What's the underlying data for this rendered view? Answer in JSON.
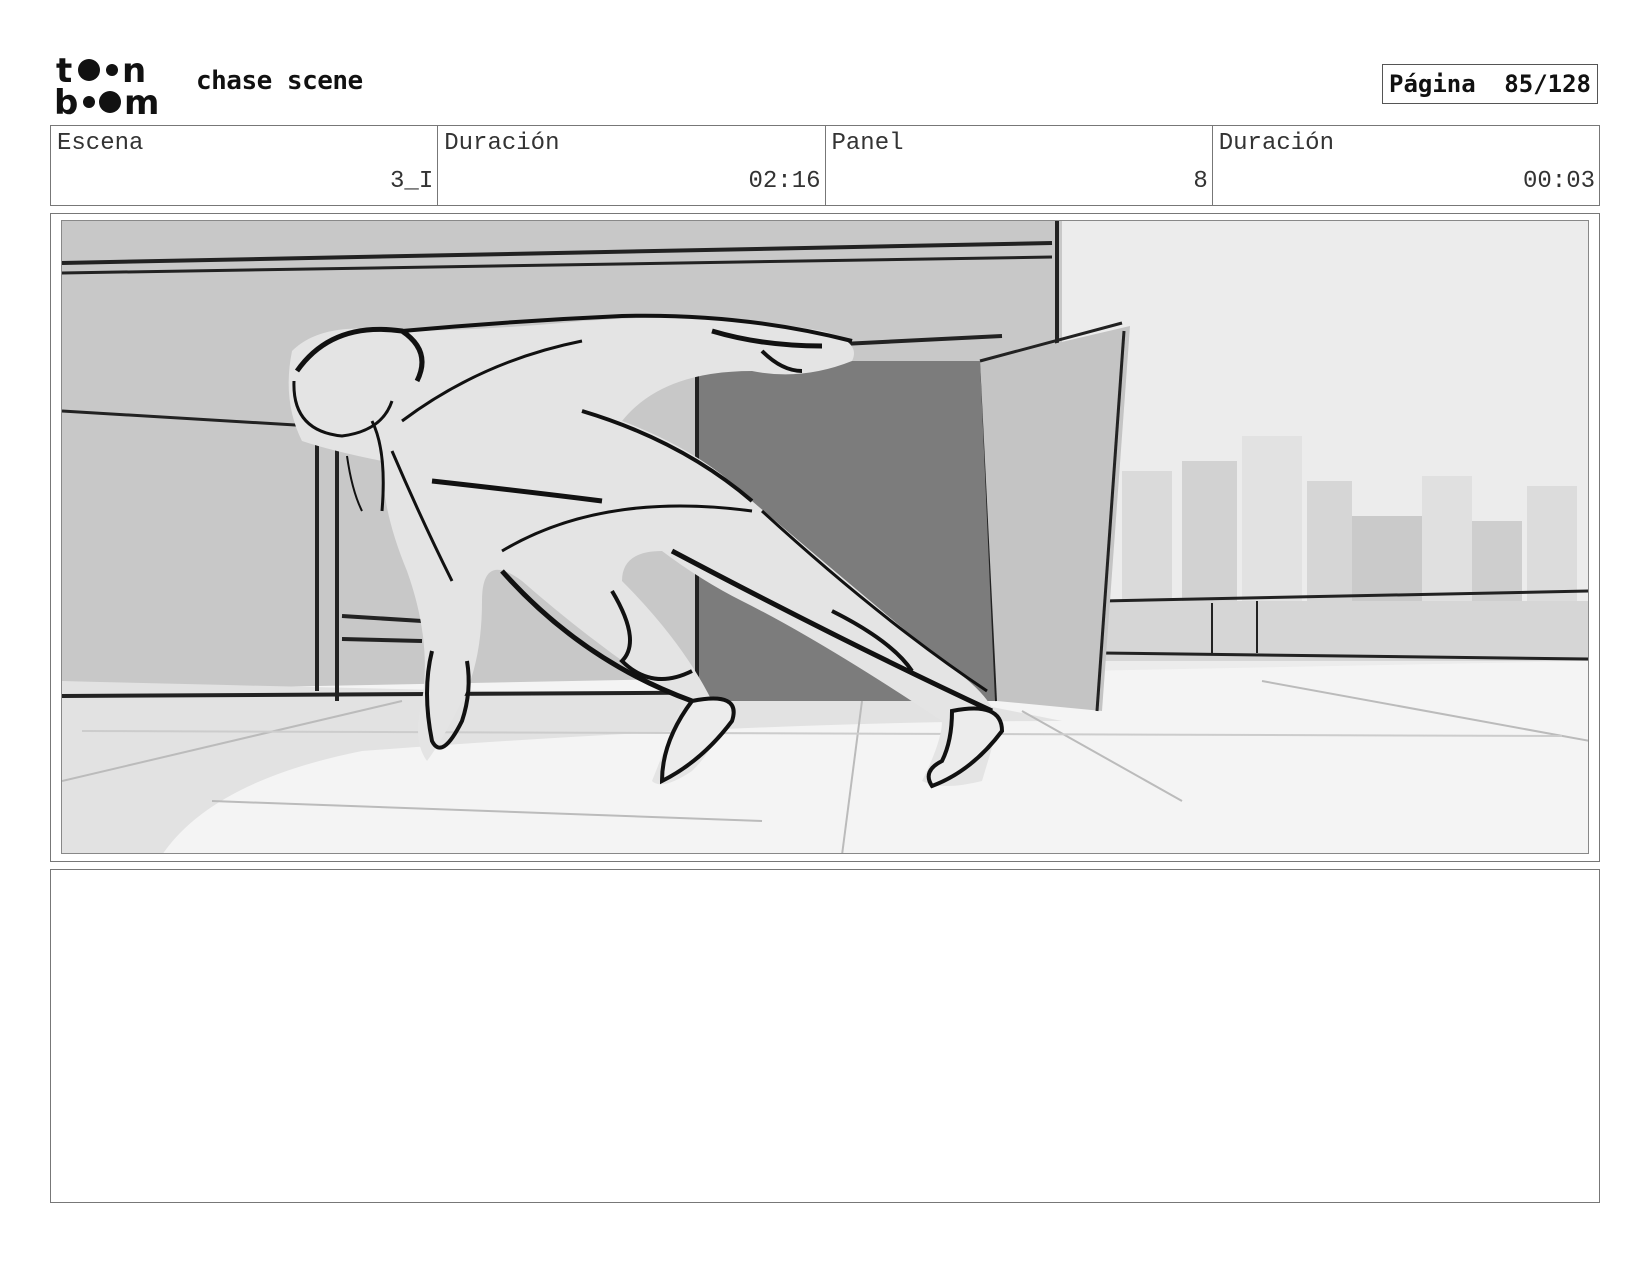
{
  "header": {
    "logo_text": "toon boom",
    "project_title": "chase scene",
    "page_label": "Página",
    "page_value": "85/128"
  },
  "info": {
    "scene_label": "Escena",
    "scene_value": "3_I",
    "scene_duration_label": "Duración",
    "scene_duration_value": "02:16",
    "panel_label": "Panel",
    "panel_value": "8",
    "panel_duration_label": "Duración",
    "panel_duration_value": "00:03"
  },
  "notes": {
    "text": ""
  }
}
